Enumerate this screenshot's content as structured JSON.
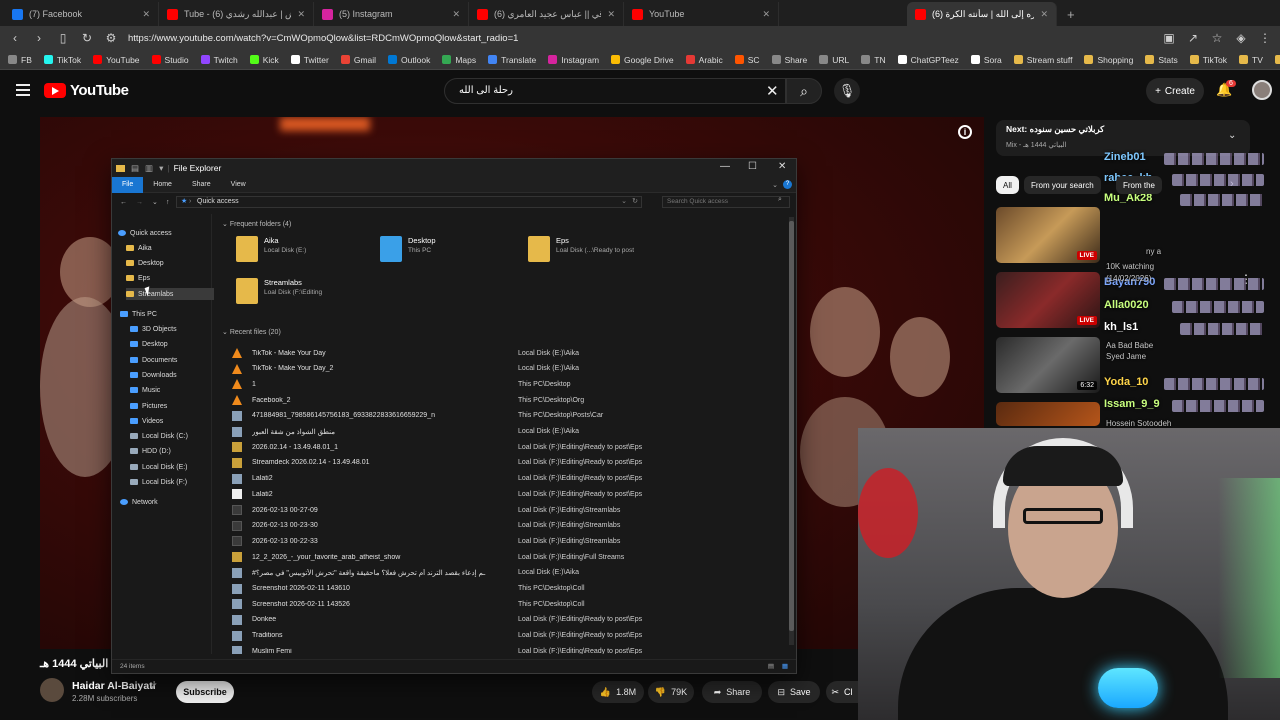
{
  "browser": {
    "tabs": [
      {
        "label": "(7) Facebook",
        "color": "#1877f2"
      },
      {
        "label": "Tube - تبرير التحرش | عبدالله رشدي (6)",
        "color": "#ff0000"
      },
      {
        "label": "(5) Instagram",
        "color": "#d6249f"
      },
      {
        "label": "اجمل ساقي || عباس عجيد العامري (6)",
        "color": "#ff0000"
      },
      {
        "label": "YouTube",
        "color": "#ff0000"
      },
      {
        "label": "(6) سفره إلى الله | سأنته الكرة",
        "color": "#ff0000"
      }
    ],
    "url": "https://www.youtube.com/watch?v=CmWOpmoQlow&list=RDCmWOpmoQlow&start_radio=1",
    "bookmarks": [
      {
        "label": "FB",
        "color": "#888"
      },
      {
        "label": "TikTok",
        "color": "#25f4ee"
      },
      {
        "label": "YouTube",
        "color": "#ff0000"
      },
      {
        "label": "Studio",
        "color": "#ff0000"
      },
      {
        "label": "Twitch",
        "color": "#9146ff"
      },
      {
        "label": "Kick",
        "color": "#53fc18"
      },
      {
        "label": "Twitter",
        "color": "#ffffff"
      },
      {
        "label": "Gmail",
        "color": "#ea4335"
      },
      {
        "label": "Outlook",
        "color": "#0078d4"
      },
      {
        "label": "Maps",
        "color": "#34a853"
      },
      {
        "label": "Translate",
        "color": "#4285f4"
      },
      {
        "label": "Instagram",
        "color": "#d6249f"
      },
      {
        "label": "Google Drive",
        "color": "#fbbc04"
      },
      {
        "label": "Arabic",
        "color": "#e53935"
      },
      {
        "label": "SC",
        "color": "#ff5500"
      },
      {
        "label": "Share",
        "color": "#888"
      },
      {
        "label": "URL",
        "color": "#888"
      },
      {
        "label": "TN",
        "color": "#888"
      },
      {
        "label": "ChatGPTeez",
        "color": "#ffffff"
      },
      {
        "label": "Sora",
        "color": "#ffffff"
      },
      {
        "label": "Stream stuff",
        "color": "#e6b94a"
      },
      {
        "label": "Shopping",
        "color": "#e6b94a"
      },
      {
        "label": "Stats",
        "color": "#e6b94a"
      },
      {
        "label": "TikTok",
        "color": "#e6b94a"
      },
      {
        "label": "TV",
        "color": "#e6b94a"
      },
      {
        "label": "Vids",
        "color": "#e6b94a"
      }
    ]
  },
  "youtube": {
    "logo_text": "YouTube",
    "search_value": "رحلة الى الله",
    "create_label": "Create",
    "notification_count": "6",
    "video_title": "البياتي 1444 هـ",
    "channel_name": "Haidar Al-Baiyati",
    "subscribers": "2.28M subscribers",
    "subscribe_label": "Subscribe",
    "likes": "1.8M",
    "dislikes": "79K",
    "share_label": "Share",
    "save_label": "Save",
    "clip_label": "Cl",
    "next_prefix": "Next:",
    "next_title": "كربلاتي حسين سنوده",
    "next_sub": "Mix - البياتي 1444 هـ",
    "chips": [
      "All",
      "From your search",
      "From the"
    ],
    "sidebar_badges": [
      "LIVE",
      "LIVE",
      "6:32"
    ]
  },
  "chat": {
    "names": [
      {
        "text": "Zineb01",
        "color": "#7ec8ff"
      },
      {
        "text": "rabee_kh",
        "color": "#7ec8ff"
      },
      {
        "text": "Mu_Ak28",
        "color": "#c8ff7e"
      },
      {
        "text": "Bayan790",
        "color": "#7ea8ff"
      },
      {
        "text": "Alla0020",
        "color": "#c8ff7e"
      },
      {
        "text": "kh_ls1",
        "color": "#ffffff"
      },
      {
        "text": "Yoda_10",
        "color": "#ffd54a"
      },
      {
        "text": "Issam_9_9",
        "color": "#c8ff7e"
      }
    ],
    "faint": [
      "ny a",
      "10K watching",
      "(14/02/2026)",
      "Aa Bad Babe",
      "Syed Jame",
      "Hossein Sotoodeh"
    ]
  },
  "explorer": {
    "title": "File Explorer",
    "ribbon_tabs": [
      "File",
      "Home",
      "Share",
      "View"
    ],
    "path": "Quick access",
    "search_placeholder": "Search Quick access",
    "nav": [
      {
        "label": "Quick access",
        "icon": "star",
        "color": "#4a9eff"
      },
      {
        "label": "Aika",
        "icon": "folder",
        "color": "#e6b94a"
      },
      {
        "label": "Desktop",
        "icon": "folder",
        "color": "#e6b94a"
      },
      {
        "label": "Eps",
        "icon": "folder",
        "color": "#e6b94a"
      },
      {
        "label": "Streamlabs",
        "icon": "folder",
        "color": "#e6b94a"
      },
      {
        "label": "This PC",
        "icon": "pc",
        "color": "#4a9eff"
      },
      {
        "label": "3D Objects",
        "icon": "folder",
        "color": "#4a9eff"
      },
      {
        "label": "Desktop",
        "icon": "folder",
        "color": "#4a9eff"
      },
      {
        "label": "Documents",
        "icon": "folder",
        "color": "#4a9eff"
      },
      {
        "label": "Downloads",
        "icon": "folder",
        "color": "#4a9eff"
      },
      {
        "label": "Music",
        "icon": "folder",
        "color": "#4a9eff"
      },
      {
        "label": "Pictures",
        "icon": "folder",
        "color": "#4a9eff"
      },
      {
        "label": "Videos",
        "icon": "folder",
        "color": "#4a9eff"
      },
      {
        "label": "Local Disk (C:)",
        "icon": "drive",
        "color": "#9ab"
      },
      {
        "label": "HDD (D:)",
        "icon": "drive",
        "color": "#9ab"
      },
      {
        "label": "Local Disk (E:)",
        "icon": "drive",
        "color": "#9ab"
      },
      {
        "label": "Local Disk (F:)",
        "icon": "drive",
        "color": "#9ab"
      },
      {
        "label": "Network",
        "icon": "network",
        "color": "#4a9eff"
      }
    ],
    "frequent_header": "Frequent folders (4)",
    "frequent": [
      {
        "name": "Aika",
        "location": "Local Disk (E:)",
        "color": "#e6b94a"
      },
      {
        "name": "Desktop",
        "location": "This PC",
        "color": "#3aa0e8"
      },
      {
        "name": "Eps",
        "location": "Loal Disk (...\\Ready to post",
        "color": "#e6b94a"
      },
      {
        "name": "Streamlabs",
        "location": "Loal Disk (F:\\Editing",
        "color": "#e6b94a"
      }
    ],
    "recent_header": "Recent files (20)",
    "recent": [
      {
        "name": "TikTok - Make Your Day",
        "location": "Local Disk (E:)\\Aika",
        "icon": "cone"
      },
      {
        "name": "TikTok - Make Your Day_2",
        "location": "Local Disk (E:)\\Aika",
        "icon": "cone"
      },
      {
        "name": "1",
        "location": "This PC\\Desktop",
        "icon": "cone"
      },
      {
        "name": "Facebook_2",
        "location": "This PC\\Desktop\\Org",
        "icon": "cone"
      },
      {
        "name": "471884981_798586145756183_6933822833616659229_n",
        "location": "This PC\\Desktop\\Posts\\Car",
        "icon": "image"
      },
      {
        "name": "منطق الشواذ من شقة العبور",
        "location": "Local Disk (E:)\\Aika",
        "icon": "image"
      },
      {
        "name": "2026.02.14 - 13.49.48.01_1",
        "location": "Loal Disk (F:)\\Editing\\Ready to post\\Eps",
        "icon": "video"
      },
      {
        "name": "Streamdeck 2026.02.14 - 13.49.48.01",
        "location": "Loal Disk (F:)\\Editing\\Ready to post\\Eps",
        "icon": "video"
      },
      {
        "name": "Lalati2",
        "location": "Loal Disk (F:)\\Editing\\Ready to post\\Eps",
        "icon": "image"
      },
      {
        "name": "Lalati2",
        "location": "Loal Disk (F:)\\Editing\\Ready to post\\Eps",
        "icon": "doc"
      },
      {
        "name": "2026-02-13 00-27-09",
        "location": "Loal Disk (F:)\\Editing\\Streamlabs",
        "icon": "dark"
      },
      {
        "name": "2026-02-13 00-23-30",
        "location": "Loal Disk (F:)\\Editing\\Streamlabs",
        "icon": "dark"
      },
      {
        "name": "2026-02-13 00-22-33",
        "location": "Loal Disk (F:)\\Editing\\Streamlabs",
        "icon": "dark"
      },
      {
        "name": "12_2_2026_-_your_favorite_arab_atheist_show",
        "location": "Loal Disk (F:)\\Editing\\Full Streams",
        "icon": "video"
      },
      {
        "name": "#ـم إدعاء بقصد الترند أم تحرش فعلا؟ ماحقيقة واقعة \"تحرش الأتوبيس\" في مصر؟",
        "location": "Local Disk (E:)\\Aika",
        "icon": "image"
      },
      {
        "name": "Screenshot 2026-02-11 143610",
        "location": "This PC\\Desktop\\Coll",
        "icon": "image"
      },
      {
        "name": "Screenshot 2026-02-11 143526",
        "location": "This PC\\Desktop\\Coll",
        "icon": "image"
      },
      {
        "name": "Donkee",
        "location": "Loal Disk (F:)\\Editing\\Ready to post\\Eps",
        "icon": "image"
      },
      {
        "name": "Traditions",
        "location": "Loal Disk (F:)\\Editing\\Ready to post\\Eps",
        "icon": "image"
      },
      {
        "name": "Muslim Femi",
        "location": "Loal Disk (F:)\\Editing\\Ready to post\\Eps",
        "icon": "image"
      }
    ],
    "status": "24 items"
  }
}
